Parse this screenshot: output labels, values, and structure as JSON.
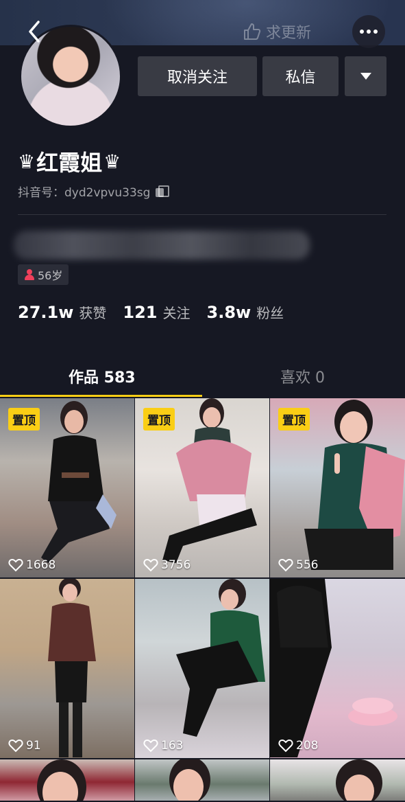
{
  "header": {
    "update_hint": "求更新"
  },
  "profile": {
    "name": "红霞姐",
    "crown_glyph": "♛",
    "douyin_id": "抖音号：dyd2vpvu33sg",
    "age_tag": "56岁"
  },
  "actions": {
    "unfollow_label": "取消关注",
    "message_label": "私信"
  },
  "stats": {
    "likes_num": "27.1w",
    "likes_label": "获赞",
    "following_num": "121",
    "following_label": "关注",
    "followers_num": "3.8w",
    "followers_label": "粉丝"
  },
  "tabs": {
    "works_label": "作品 583",
    "likes_label": "喜欢 0"
  },
  "videos": [
    {
      "pinned": "置顶",
      "likes": "1668"
    },
    {
      "pinned": "置顶",
      "likes": "3756"
    },
    {
      "pinned": "置顶",
      "likes": "556"
    },
    {
      "likes": "91"
    },
    {
      "likes": "163"
    },
    {
      "likes": "208"
    }
  ],
  "colors": {
    "background": "#161823",
    "accent_yellow": "#face15",
    "button_gray": "#393b44",
    "age_icon_red": "#f1405b"
  }
}
